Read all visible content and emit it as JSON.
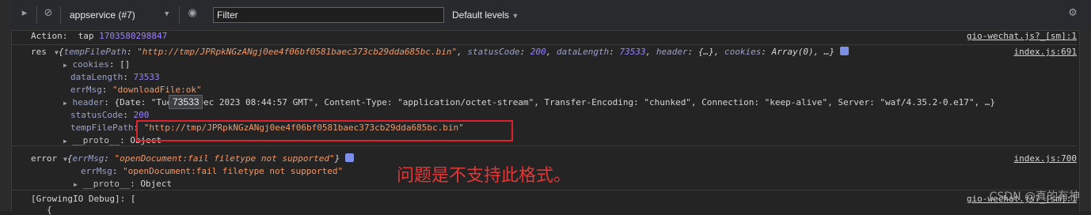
{
  "toolbar": {
    "context": "appservice (#7)",
    "filter_placeholder": "Filter",
    "levels": "Default levels",
    "levels_caret": "▼",
    "context_caret": "▼"
  },
  "log": {
    "action": {
      "prefix": "Action:",
      "label": "tap",
      "value": "1703580298847",
      "source": "gio-wechat.js?_[sm]:1"
    },
    "res": {
      "label": "res",
      "summary_open": "{",
      "summary_k1": "tempFilePath",
      "summary_v1": "\"http://tmp/JPRpkNGzANgj0ee4f06bf0581baec373cb29dda685bc.bin\"",
      "summary_k2": "statusCode",
      "summary_v2": "200",
      "summary_k3": "dataLength",
      "summary_v3": "73533",
      "summary_k4": "header",
      "summary_v4": "{…}",
      "summary_k5": "cookies",
      "summary_v5": "Array(0)",
      "summary_close": ", …}",
      "source": "index.js:691",
      "cookies_key": "cookies",
      "cookies_val": "[]",
      "dataLength_key": "dataLength",
      "dataLength_val": "73533",
      "errMsg_key": "errMsg",
      "errMsg_val": "\"downloadFile:ok\"",
      "header_key": "header",
      "header_rest": "{Date: \"Tue, 26 Dec 2023 08:44:57 GMT\", Content-Type: \"application/octet-stream\", Transfer-Encoding: \"chunked\", Connection: \"keep-alive\", Server: \"waf/4.35.2-0.e17\", …}",
      "statusCode_key": "statusCode",
      "statusCode_val": "200",
      "tempFilePath_key": "tempFilePath",
      "tempFilePath_val": "\"http://tmp/JPRpkNGzANgj0ee4f06bf0581baec373cb29dda685bc.bin\"",
      "proto_key": "__proto__",
      "proto_val": "Object"
    },
    "tooltip": "73533",
    "error": {
      "label": "error",
      "summary_k": "errMsg",
      "summary_v": "\"openDocument:fail filetype not supported\"",
      "source": "index.js:700",
      "errMsg_key": "errMsg",
      "errMsg_val": "\"openDocument:fail filetype not supported\"",
      "proto_key": "__proto__",
      "proto_val": "Object"
    },
    "growing": {
      "text": "[GrowingIO Debug]: [",
      "source": "gio-wechat.js?_[sm]:1",
      "next": "{"
    }
  },
  "annotation": "问题是不支持此格式。",
  "watermark": "CSDN @真的有神",
  "colors": {
    "highlight_box": "#e0202a",
    "annotation": "#e33636",
    "badge": "#7c8ee8"
  }
}
